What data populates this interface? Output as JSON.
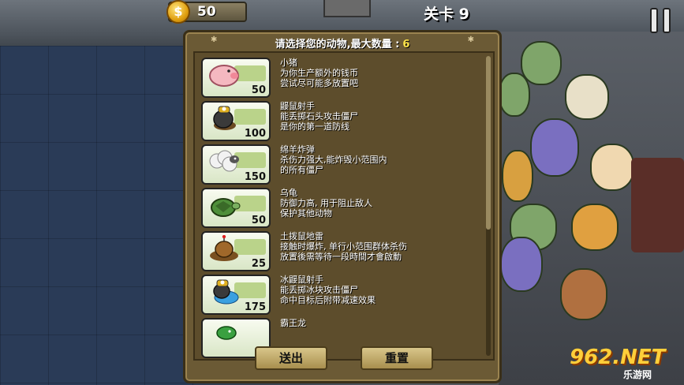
{
  "hud": {
    "coins": "50",
    "coin_symbol": "$",
    "level": "关卡 9"
  },
  "dialog": {
    "title": "请选择您的动物,最大数量 :",
    "max_count": "6"
  },
  "animals": [
    {
      "name": "小猪",
      "line1": "为你生产额外的钱币",
      "line2": "尝试尽可能多放置吧",
      "cost": "50",
      "icon": "pig-icon"
    },
    {
      "name": "鼹鼠射手",
      "line1": "能丢掷石头攻击僵尸",
      "line2": "是你的第一道防线",
      "cost": "100",
      "icon": "mole-shooter-icon"
    },
    {
      "name": "绵羊炸弹",
      "line1": "杀伤力强大,能炸毁小范围内",
      "line2": "的所有僵尸",
      "cost": "150",
      "icon": "sheep-bomb-icon"
    },
    {
      "name": "乌龟",
      "line1": "防御力高, 用于阻止敌人",
      "line2": "保护其他动物",
      "cost": "50",
      "icon": "turtle-icon"
    },
    {
      "name": "土拨鼠地雷",
      "line1": "接触时爆炸, 单行小范围群体杀伤",
      "line2": "放置後需等待一段時間才會啟動",
      "cost": "25",
      "icon": "gopher-mine-icon"
    },
    {
      "name": "冰鼹鼠射手",
      "line1": "能丢掷冰块攻击僵尸",
      "line2": "命中目标后附带减速效果",
      "cost": "175",
      "icon": "ice-mole-shooter-icon"
    },
    {
      "name": "霸王龙",
      "line1": "",
      "line2": "",
      "cost": "",
      "icon": "trex-icon"
    }
  ],
  "buttons": {
    "send": "送出",
    "reset": "重置"
  },
  "watermark": {
    "num": "962.NET",
    "sub": "乐游网"
  },
  "colors": {
    "dialog_bg": "#6b5a35",
    "accent_yellow": "#ffe44a"
  }
}
